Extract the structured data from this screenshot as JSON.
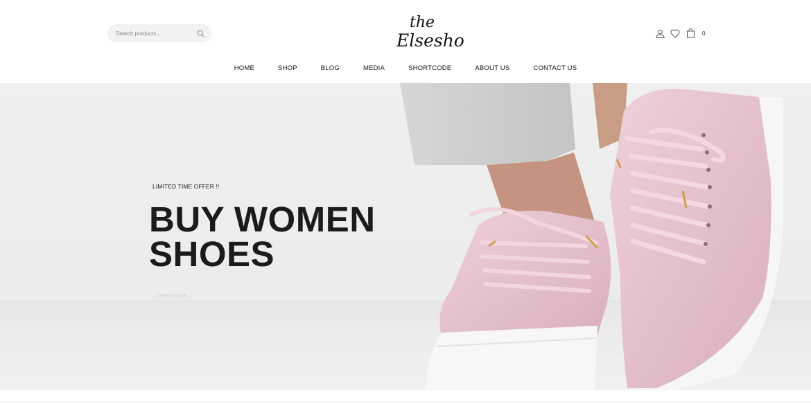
{
  "search": {
    "placeholder": "Search products..."
  },
  "logo": {
    "line1": "the",
    "line2": "Elsesho"
  },
  "header_actions": {
    "cart_count": "0"
  },
  "nav": {
    "items": [
      "HOME",
      "SHOP",
      "BLOG",
      "MEDIA",
      "SHORTCODE",
      "ABOUT US",
      "CONTACT US"
    ]
  },
  "hero": {
    "eyebrow": "LIMITED TIME OFFER !!",
    "headline_line1": "BUY WOMEN",
    "headline_line2": "SHOES",
    "button_label": "VIEW MORE"
  },
  "colors": {
    "shoe_pink": "#e7c3cf",
    "sole": "#f7f7f7",
    "pants": "#cdcdcd",
    "text_dark": "#1b1b1b"
  }
}
